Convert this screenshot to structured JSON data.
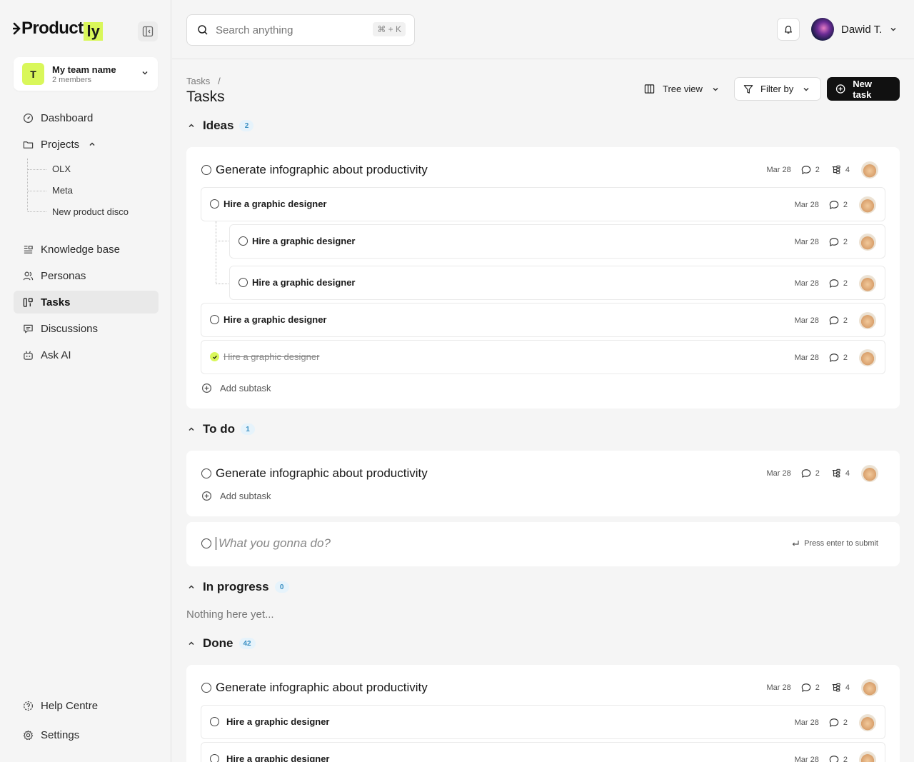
{
  "app": {
    "logo_text": "Product",
    "logo_suffix": "ly"
  },
  "team": {
    "avatar_letter": "T",
    "name": "My team name",
    "members": "2 members"
  },
  "nav": {
    "dashboard": "Dashboard",
    "projects": "Projects",
    "projects_children": [
      "OLX",
      "Meta",
      "New product disco"
    ],
    "knowledge": "Knowledge base",
    "personas": "Personas",
    "tasks": "Tasks",
    "discussions": "Discussions",
    "ask_ai": "Ask AI",
    "help": "Help Centre",
    "settings": "Settings"
  },
  "search": {
    "placeholder": "Search anything",
    "shortcut": "⌘ + K"
  },
  "user": {
    "name": "Dawid T."
  },
  "page": {
    "breadcrumb": "Tasks   /",
    "title": "Tasks"
  },
  "toolbar": {
    "tree_view": "Tree view",
    "filter": "Filter by",
    "new_task": "New task"
  },
  "groups": {
    "ideas": {
      "title": "Ideas",
      "count": "2"
    },
    "todo": {
      "title": "To do",
      "count": "1"
    },
    "in_progress": {
      "title": "In progress",
      "count": "0",
      "empty": "Nothing here yet..."
    },
    "done": {
      "title": "Done",
      "count": "42"
    }
  },
  "task": {
    "title": "Generate infographic about productivity",
    "date": "Mar 28",
    "comments": "2",
    "subtasks": "4",
    "subtask_title": "Hire a graphic designer",
    "add_subtask": "Add subtask"
  },
  "new_task_input": {
    "placeholder": "What you gonna do?",
    "hint": "Press enter to submit"
  },
  "colors": {
    "accent": "#d9f75a",
    "badge_bg": "#e6f3fb",
    "badge_text": "#3a8fc2",
    "primary_button": "#111111"
  }
}
